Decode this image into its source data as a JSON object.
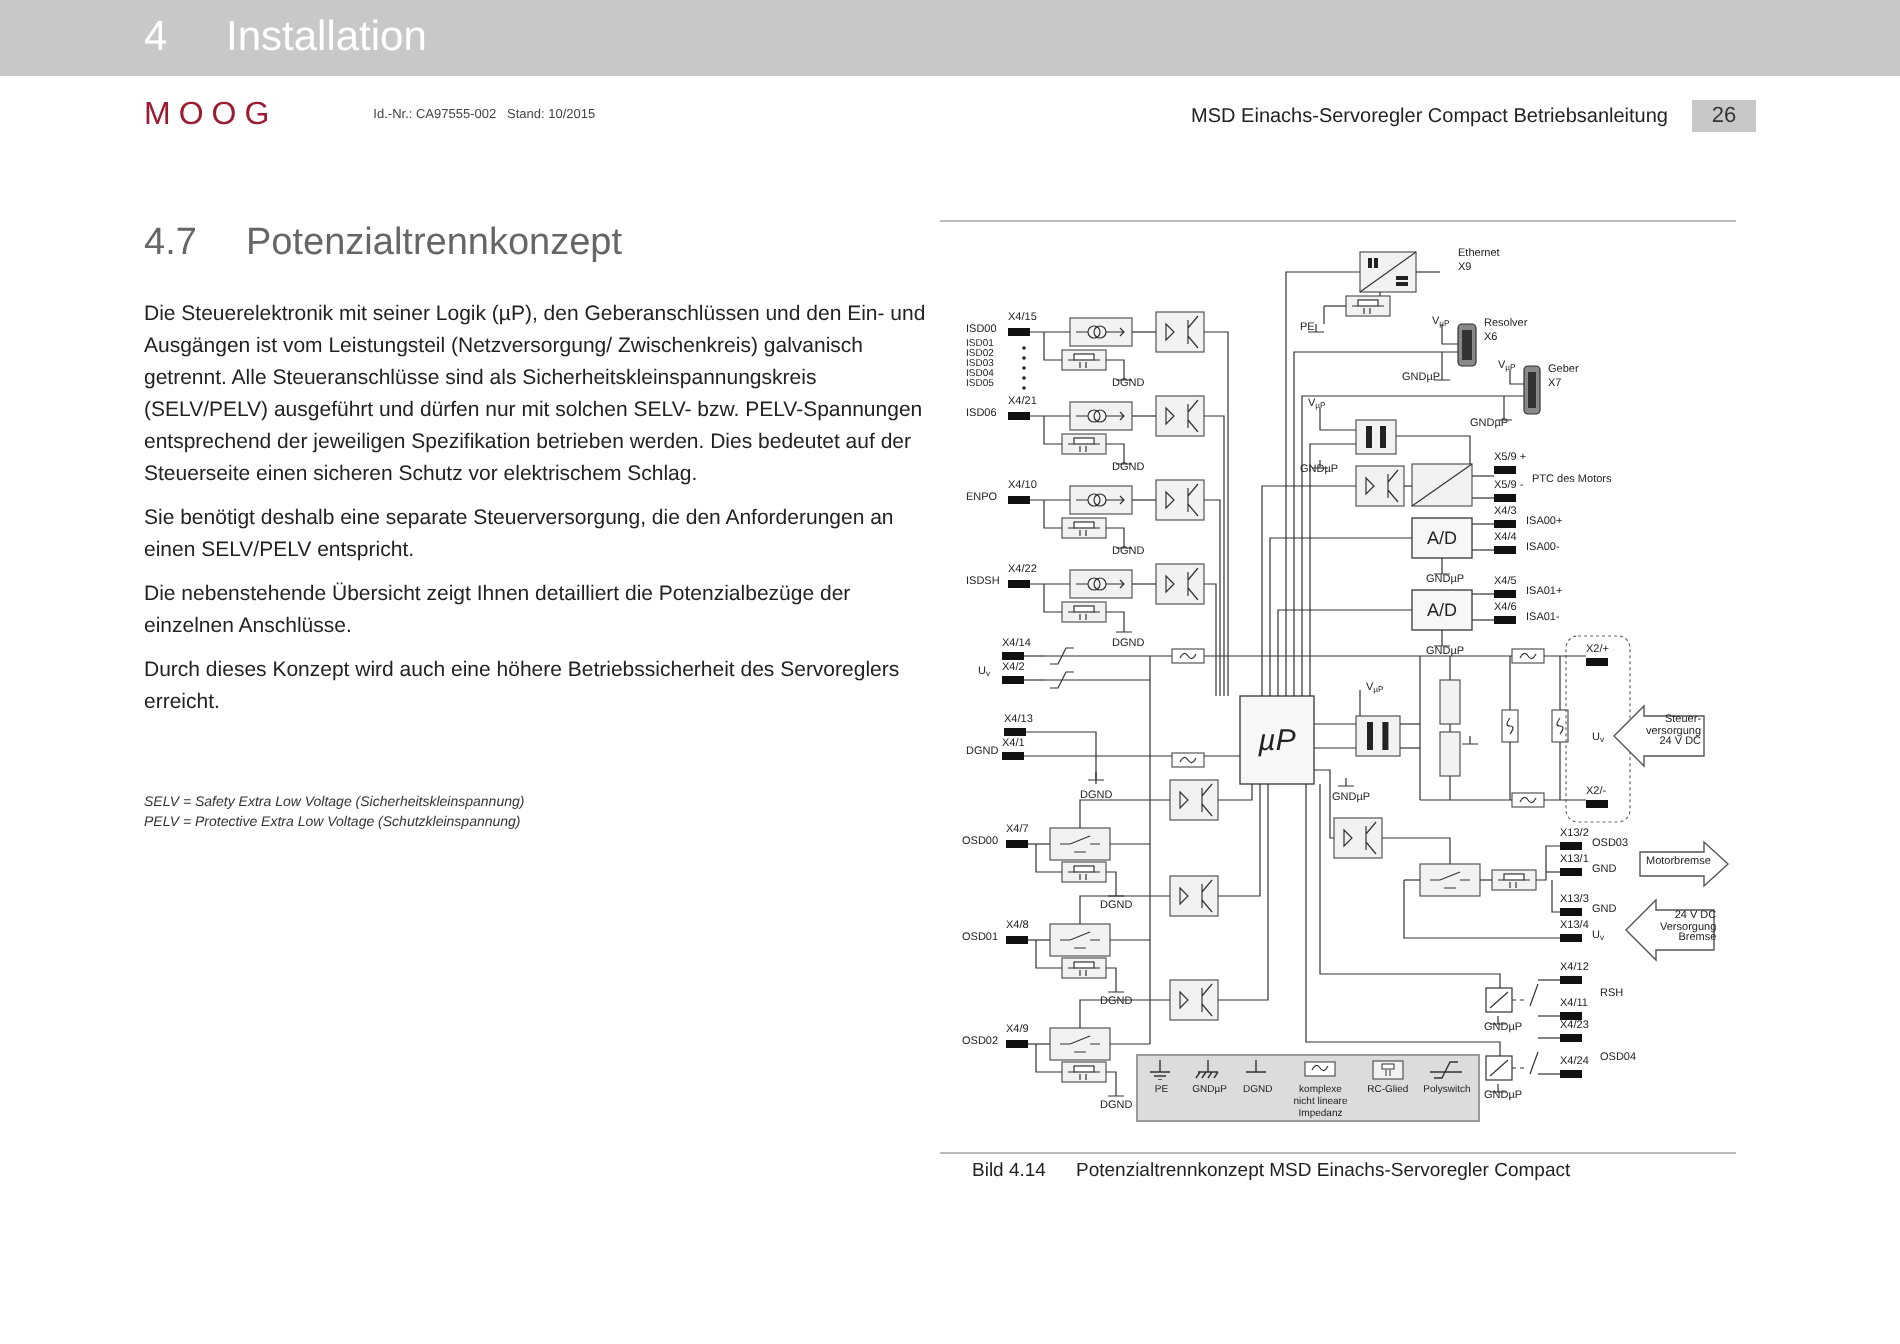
{
  "header": {
    "chapter_number": "4",
    "chapter_title": "Installation"
  },
  "subheader": {
    "logo": "MOOG",
    "document_id": "Id.-Nr.: CA97555-002   Stand: 10/2015",
    "document_title": "MSD Einachs-Servoregler Compact Betriebsanleitung",
    "page_number": "26"
  },
  "section": {
    "number": "4.7",
    "title": "Potenzialtrennkonzept",
    "paragraphs": [
      "Die Steuerelektronik mit seiner Logik (µP), den Geberanschlüssen und den Ein- und Ausgängen ist vom Leistungsteil (Netzversorgung/ Zwischenkreis) galvanisch getrennt. Alle Steueranschlüsse sind als Sicherheitskleinspannungskreis (SELV/PELV) ausgeführt und dürfen nur mit solchen SELV- bzw. PELV-Spannungen entsprechend der jeweiligen Spezifikation betrieben werden. Dies bedeutet auf der Steuerseite einen sicheren Schutz vor elektrischem Schlag.",
      "Sie benötigt deshalb eine separate Steuerversorgung, die den Anforderungen an einen SELV/PELV entspricht.",
      "Die nebenstehende Übersicht zeigt Ihnen detailliert die Potenzialbezüge der einzelnen Anschlüsse.",
      "Durch dieses Konzept wird auch eine höhere Betriebssicherheit des Servoreglers erreicht."
    ],
    "footnotes": [
      "SELV = Safety Extra Low Voltage (Sicherheitskleinspannung)",
      "PELV = Protective Extra Low Voltage (Schutzkleinspannung)"
    ]
  },
  "figure": {
    "caption_number": "Bild 4.14",
    "caption_text": "Potenzialtrennkonzept MSD Einachs-Servoregler Compact",
    "diagram": {
      "inputs": [
        {
          "name": "ISD00",
          "connector": "X4/15"
        },
        {
          "name": "ISD06",
          "connector": "X4/21"
        },
        {
          "name": "ENPO",
          "connector": "X4/10"
        },
        {
          "name": "ISDSH",
          "connector": "X4/22"
        }
      ],
      "grouped_inputs": [
        "ISD01",
        "ISD02",
        "ISD03",
        "ISD04",
        "ISD05"
      ],
      "outputs": [
        {
          "name": "OSD00",
          "connector": "X4/7"
        },
        {
          "name": "OSD01",
          "connector": "X4/8"
        },
        {
          "name": "OSD02",
          "connector": "X4/9"
        }
      ],
      "pins": [
        {
          "connector": "X4/14"
        },
        {
          "connector": "X4/2"
        },
        {
          "connector": "X4/13"
        },
        {
          "connector": "X4/1"
        },
        {
          "connector": "X5/9 +"
        },
        {
          "connector": "X5/9 -"
        },
        {
          "connector": "X4/3",
          "signal": "ISA00+"
        },
        {
          "connector": "X4/4",
          "signal": "ISA00-"
        },
        {
          "connector": "X4/5",
          "signal": "ISA01+"
        },
        {
          "connector": "X4/6",
          "signal": "ISA01-"
        },
        {
          "connector": "X2/+"
        },
        {
          "connector": "X2/-"
        },
        {
          "connector": "X13/2",
          "signal": "OSD03"
        },
        {
          "connector": "X13/1",
          "signal": "GND"
        },
        {
          "connector": "X13/3",
          "signal": "GND"
        },
        {
          "connector": "X13/4",
          "signal": "U$_{v}$"
        },
        {
          "connector": "X4/12"
        },
        {
          "connector": "X4/11"
        },
        {
          "connector": "X4/23"
        },
        {
          "connector": "X4/24"
        }
      ],
      "blocks": [
        "µP",
        "A/D",
        "A/D"
      ],
      "labels": [
        "PE",
        "Ethernet",
        "X9",
        "V$_{µP}$",
        "Resolver",
        "X6",
        "GNDµP",
        "V$_{µP}$",
        "Geber",
        "X7",
        "GNDµP",
        "V$_{µP}$",
        "GNDµP",
        "PTC des Motors",
        "GNDµP",
        "GNDµP",
        "DGND",
        "DGND",
        "DGND",
        "DGND",
        "U$_{v}$",
        "DGND",
        "DGND",
        "V$_{µP}$",
        "GNDµP",
        "U$_{v}$",
        "DGND",
        "DGND",
        "DGND",
        "RSH",
        "OSD04",
        "GNDµP",
        "GNDµP"
      ],
      "arrows": [
        {
          "lines": [
            "Steuer-",
            "versorgung",
            "24 V DC"
          ]
        },
        {
          "lines": [
            "Motorbremse"
          ]
        },
        {
          "lines": [
            "24 V DC",
            "Versorgung",
            "Bremse"
          ]
        }
      ],
      "legend": [
        {
          "kind": "pe",
          "label": "PE"
        },
        {
          "kind": "gnd_up",
          "label": "GNDµP"
        },
        {
          "kind": "dgnd",
          "label": "DGND"
        },
        {
          "kind": "impedance",
          "label": "komplexe nicht lineare Impedanz"
        },
        {
          "kind": "rc",
          "label": "RC-Glied"
        },
        {
          "kind": "polyswitch",
          "label": "Polyswitch"
        }
      ]
    }
  }
}
